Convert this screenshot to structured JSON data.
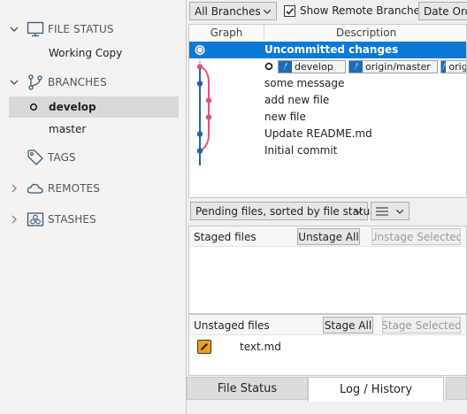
{
  "sidebar": {
    "file_status": {
      "title": "FILE STATUS",
      "items": [
        {
          "label": "Working Copy"
        }
      ]
    },
    "branches": {
      "title": "BRANCHES",
      "items": [
        {
          "label": "develop",
          "selected": true
        },
        {
          "label": "master"
        }
      ]
    },
    "tags": {
      "title": "TAGS"
    },
    "remotes": {
      "title": "REMOTES"
    },
    "stashes": {
      "title": "STASHES"
    }
  },
  "toolbar": {
    "branch_filter": "All Branches",
    "show_remote_label": "Show Remote Branches",
    "show_remote_checked": true,
    "sort_order": "Date Order"
  },
  "history": {
    "columns": {
      "graph": "Graph",
      "description": "Description"
    },
    "rows": [
      {
        "description": "Uncommitted changes",
        "selected": true
      },
      {
        "description": "",
        "tags": [
          "develop",
          "origin/master",
          "origin/develop"
        ]
      },
      {
        "description": "some message"
      },
      {
        "description": "add new file"
      },
      {
        "description": "new file"
      },
      {
        "description": "Update README.md"
      },
      {
        "description": "Initial commit"
      }
    ]
  },
  "pending": {
    "view_mode": "Pending files, sorted by file status",
    "staged": {
      "title": "Staged files",
      "unstage_all": "Unstage All",
      "unstage_selected": "Unstage Selected"
    },
    "unstaged": {
      "title": "Unstaged files",
      "stage_all": "Stage All",
      "stage_selected": "Stage Selected",
      "files": [
        {
          "name": "text.md",
          "status": "modified"
        }
      ]
    }
  },
  "tabs": {
    "file_status": "File Status",
    "log_history": "Log / History"
  },
  "colors": {
    "selection": "#0a7ad5",
    "graph_blue": "#1f63a8",
    "graph_pink": "#e05379",
    "modified": "#f0a01e"
  }
}
